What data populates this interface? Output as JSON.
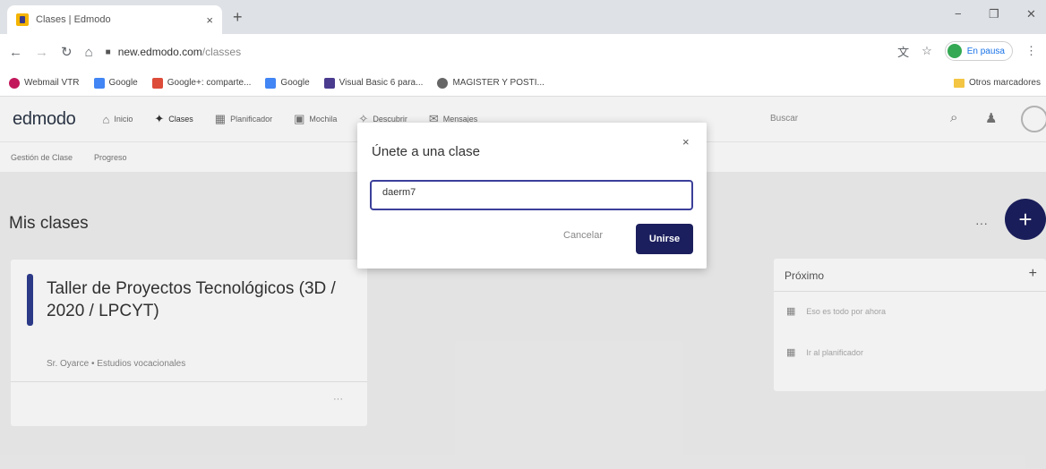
{
  "browser": {
    "tab_title": "Clases | Edmodo",
    "tab_close": "×",
    "new_tab": "+",
    "win_minimize": "−",
    "win_restore": "❐",
    "win_close": "✕",
    "url_host": "new.edmodo.com",
    "url_path": "/classes",
    "profile_status": "En pausa",
    "bookmarks": [
      {
        "label": "Webmail VTR",
        "icon": "heart-icon",
        "color": "#c2185b"
      },
      {
        "label": "Google",
        "icon": "google-icon",
        "color": "#4285f4"
      },
      {
        "label": "Google+: comparte...",
        "icon": "google-plus-icon",
        "color": "#dd4b39"
      },
      {
        "label": "Google",
        "icon": "google-translate-icon",
        "color": "#4285f4"
      },
      {
        "label": "Visual Basic 6 para...",
        "icon": "vb-icon",
        "color": "#4a3b8f"
      },
      {
        "label": "MAGISTER Y POSTI...",
        "icon": "globe-icon",
        "color": "#666666"
      }
    ],
    "other_bookmarks": "Otros marcadores"
  },
  "app": {
    "logo": "edmodo",
    "nav": [
      {
        "label": "Inicio",
        "icon": "home-icon"
      },
      {
        "label": "Clases",
        "icon": "people-icon"
      },
      {
        "label": "Planificador",
        "icon": "calendar-icon"
      },
      {
        "label": "Mochila",
        "icon": "backpack-icon"
      },
      {
        "label": "Descubrir",
        "icon": "compass-icon"
      },
      {
        "label": "Mensajes",
        "icon": "message-icon"
      }
    ],
    "search_placeholder": "Buscar",
    "subnav": [
      "Gestión de Clase",
      "Progreso"
    ],
    "section_title": "Mis clases",
    "more": "···",
    "fab": "+",
    "class_card": {
      "name": "Taller de Proyectos Tecnológicos (3D / 2020 / LPCYT)",
      "meta": "Sr. Oyarce • Estudios vocacionales",
      "more": "···",
      "accent": "#2e3d8f"
    },
    "proximo": {
      "title": "Próximo",
      "add": "+",
      "rows": [
        "Eso es todo por ahora",
        "Ir al planificador"
      ]
    }
  },
  "modal": {
    "title": "Únete a una clase",
    "close": "×",
    "code_value": "daerm7",
    "cancel": "Cancelar",
    "join": "Unirse",
    "primary_color": "#1b1f5e"
  }
}
